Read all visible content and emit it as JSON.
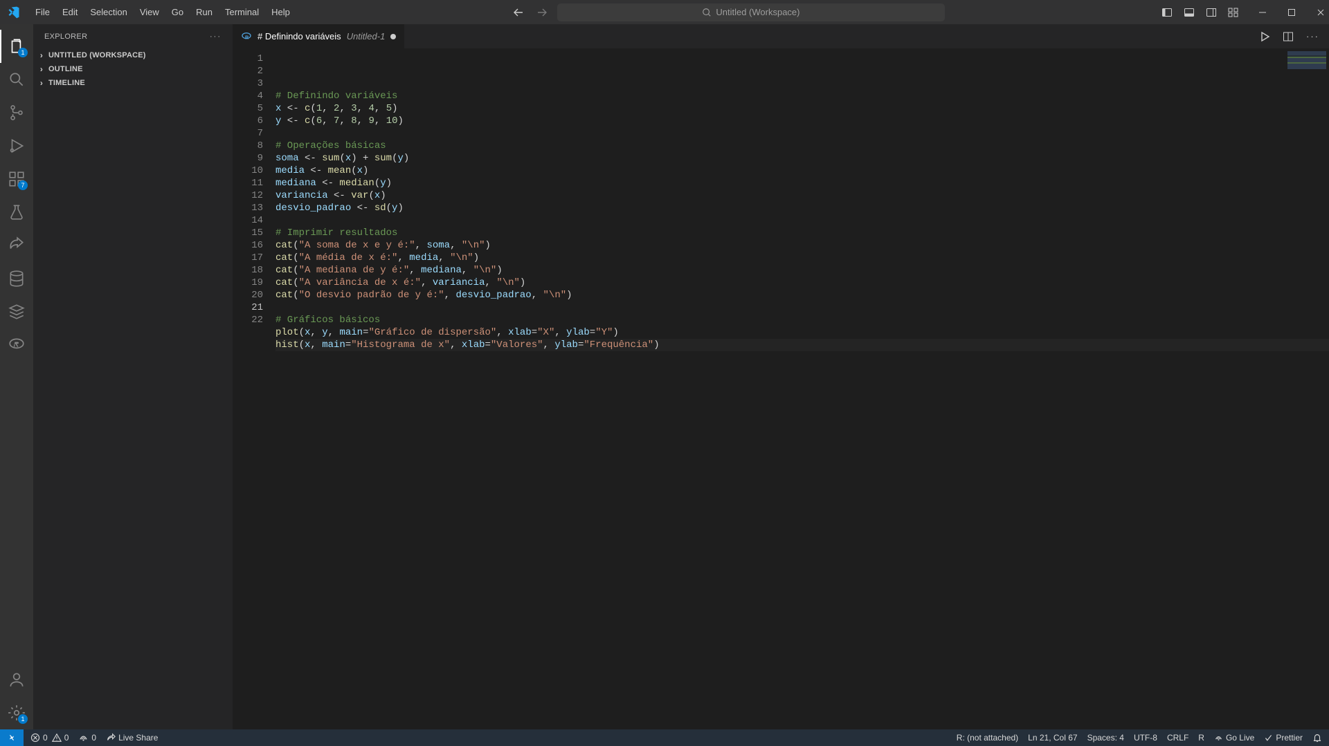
{
  "menu": [
    "File",
    "Edit",
    "Selection",
    "View",
    "Go",
    "Run",
    "Terminal",
    "Help"
  ],
  "search_placeholder": "Untitled (Workspace)",
  "sidebar": {
    "title": "EXPLORER",
    "sections": [
      "UNTITLED (WORKSPACE)",
      "OUTLINE",
      "TIMELINE"
    ]
  },
  "activity_badges": {
    "explorer": "1",
    "extensions": "7",
    "settings": "1"
  },
  "tab": {
    "title": "# Definindo variáveis",
    "subtitle": "Untitled-1"
  },
  "code": {
    "lines": [
      [
        [
          "cm",
          "# Definindo variáveis"
        ]
      ],
      [
        [
          "id",
          "x"
        ],
        [
          "op",
          " <- "
        ],
        [
          "fn",
          "c"
        ],
        [
          "op",
          "("
        ],
        [
          "num",
          "1"
        ],
        [
          "op",
          ", "
        ],
        [
          "num",
          "2"
        ],
        [
          "op",
          ", "
        ],
        [
          "num",
          "3"
        ],
        [
          "op",
          ", "
        ],
        [
          "num",
          "4"
        ],
        [
          "op",
          ", "
        ],
        [
          "num",
          "5"
        ],
        [
          "op",
          ")"
        ]
      ],
      [
        [
          "id",
          "y"
        ],
        [
          "op",
          " <- "
        ],
        [
          "fn",
          "c"
        ],
        [
          "op",
          "("
        ],
        [
          "num",
          "6"
        ],
        [
          "op",
          ", "
        ],
        [
          "num",
          "7"
        ],
        [
          "op",
          ", "
        ],
        [
          "num",
          "8"
        ],
        [
          "op",
          ", "
        ],
        [
          "num",
          "9"
        ],
        [
          "op",
          ", "
        ],
        [
          "num",
          "10"
        ],
        [
          "op",
          ")"
        ]
      ],
      [],
      [
        [
          "cm",
          "# Operações básicas"
        ]
      ],
      [
        [
          "id",
          "soma"
        ],
        [
          "op",
          " <- "
        ],
        [
          "fn",
          "sum"
        ],
        [
          "op",
          "("
        ],
        [
          "id",
          "x"
        ],
        [
          "op",
          ") + "
        ],
        [
          "fn",
          "sum"
        ],
        [
          "op",
          "("
        ],
        [
          "id",
          "y"
        ],
        [
          "op",
          ")"
        ]
      ],
      [
        [
          "id",
          "media"
        ],
        [
          "op",
          " <- "
        ],
        [
          "fn",
          "mean"
        ],
        [
          "op",
          "("
        ],
        [
          "id",
          "x"
        ],
        [
          "op",
          ")"
        ]
      ],
      [
        [
          "id",
          "mediana"
        ],
        [
          "op",
          " <- "
        ],
        [
          "fn",
          "median"
        ],
        [
          "op",
          "("
        ],
        [
          "id",
          "y"
        ],
        [
          "op",
          ")"
        ]
      ],
      [
        [
          "id",
          "variancia"
        ],
        [
          "op",
          " <- "
        ],
        [
          "fn",
          "var"
        ],
        [
          "op",
          "("
        ],
        [
          "id",
          "x"
        ],
        [
          "op",
          ")"
        ]
      ],
      [
        [
          "id",
          "desvio_padrao"
        ],
        [
          "op",
          " <- "
        ],
        [
          "fn",
          "sd"
        ],
        [
          "op",
          "("
        ],
        [
          "id",
          "y"
        ],
        [
          "op",
          ")"
        ]
      ],
      [],
      [
        [
          "cm",
          "# Imprimir resultados"
        ]
      ],
      [
        [
          "fn",
          "cat"
        ],
        [
          "op",
          "("
        ],
        [
          "str",
          "\"A soma de x e y é:\""
        ],
        [
          "op",
          ", "
        ],
        [
          "id",
          "soma"
        ],
        [
          "op",
          ", "
        ],
        [
          "str",
          "\"\\n\""
        ],
        [
          "op",
          ")"
        ]
      ],
      [
        [
          "fn",
          "cat"
        ],
        [
          "op",
          "("
        ],
        [
          "str",
          "\"A média de x é:\""
        ],
        [
          "op",
          ", "
        ],
        [
          "id",
          "media"
        ],
        [
          "op",
          ", "
        ],
        [
          "str",
          "\"\\n\""
        ],
        [
          "op",
          ")"
        ]
      ],
      [
        [
          "fn",
          "cat"
        ],
        [
          "op",
          "("
        ],
        [
          "str",
          "\"A mediana de y é:\""
        ],
        [
          "op",
          ", "
        ],
        [
          "id",
          "mediana"
        ],
        [
          "op",
          ", "
        ],
        [
          "str",
          "\"\\n\""
        ],
        [
          "op",
          ")"
        ]
      ],
      [
        [
          "fn",
          "cat"
        ],
        [
          "op",
          "("
        ],
        [
          "str",
          "\"A variância de x é:\""
        ],
        [
          "op",
          ", "
        ],
        [
          "id",
          "variancia"
        ],
        [
          "op",
          ", "
        ],
        [
          "str",
          "\"\\n\""
        ],
        [
          "op",
          ")"
        ]
      ],
      [
        [
          "fn",
          "cat"
        ],
        [
          "op",
          "("
        ],
        [
          "str",
          "\"O desvio padrão de y é:\""
        ],
        [
          "op",
          ", "
        ],
        [
          "id",
          "desvio_padrao"
        ],
        [
          "op",
          ", "
        ],
        [
          "str",
          "\"\\n\""
        ],
        [
          "op",
          ")"
        ]
      ],
      [],
      [
        [
          "cm",
          "# Gráficos básicos"
        ]
      ],
      [
        [
          "fn",
          "plot"
        ],
        [
          "op",
          "("
        ],
        [
          "id",
          "x"
        ],
        [
          "op",
          ", "
        ],
        [
          "id",
          "y"
        ],
        [
          "op",
          ", "
        ],
        [
          "prm",
          "main"
        ],
        [
          "op",
          "="
        ],
        [
          "str",
          "\"Gráfico de dispersão\""
        ],
        [
          "op",
          ", "
        ],
        [
          "prm",
          "xlab"
        ],
        [
          "op",
          "="
        ],
        [
          "str",
          "\"X\""
        ],
        [
          "op",
          ", "
        ],
        [
          "prm",
          "ylab"
        ],
        [
          "op",
          "="
        ],
        [
          "str",
          "\"Y\""
        ],
        [
          "op",
          ")"
        ]
      ],
      [
        [
          "fn",
          "hist"
        ],
        [
          "op",
          "("
        ],
        [
          "id",
          "x"
        ],
        [
          "op",
          ", "
        ],
        [
          "prm",
          "main"
        ],
        [
          "op",
          "="
        ],
        [
          "str",
          "\"Histograma de x\""
        ],
        [
          "op",
          ", "
        ],
        [
          "prm",
          "xlab"
        ],
        [
          "op",
          "="
        ],
        [
          "str",
          "\"Valores\""
        ],
        [
          "op",
          ", "
        ],
        [
          "prm",
          "ylab"
        ],
        [
          "op",
          "="
        ],
        [
          "str",
          "\"Frequência\""
        ],
        [
          "op",
          ")"
        ]
      ],
      []
    ],
    "active_line": 21
  },
  "status": {
    "errors": "0",
    "warnings": "0",
    "ports": "0",
    "live_share": "Live Share",
    "r_status": "R: (not attached)",
    "cursor": "Ln 21, Col 67",
    "spaces": "Spaces: 4",
    "encoding": "UTF-8",
    "eol": "CRLF",
    "lang": "R",
    "go_live": "Go Live",
    "prettier": "Prettier"
  }
}
